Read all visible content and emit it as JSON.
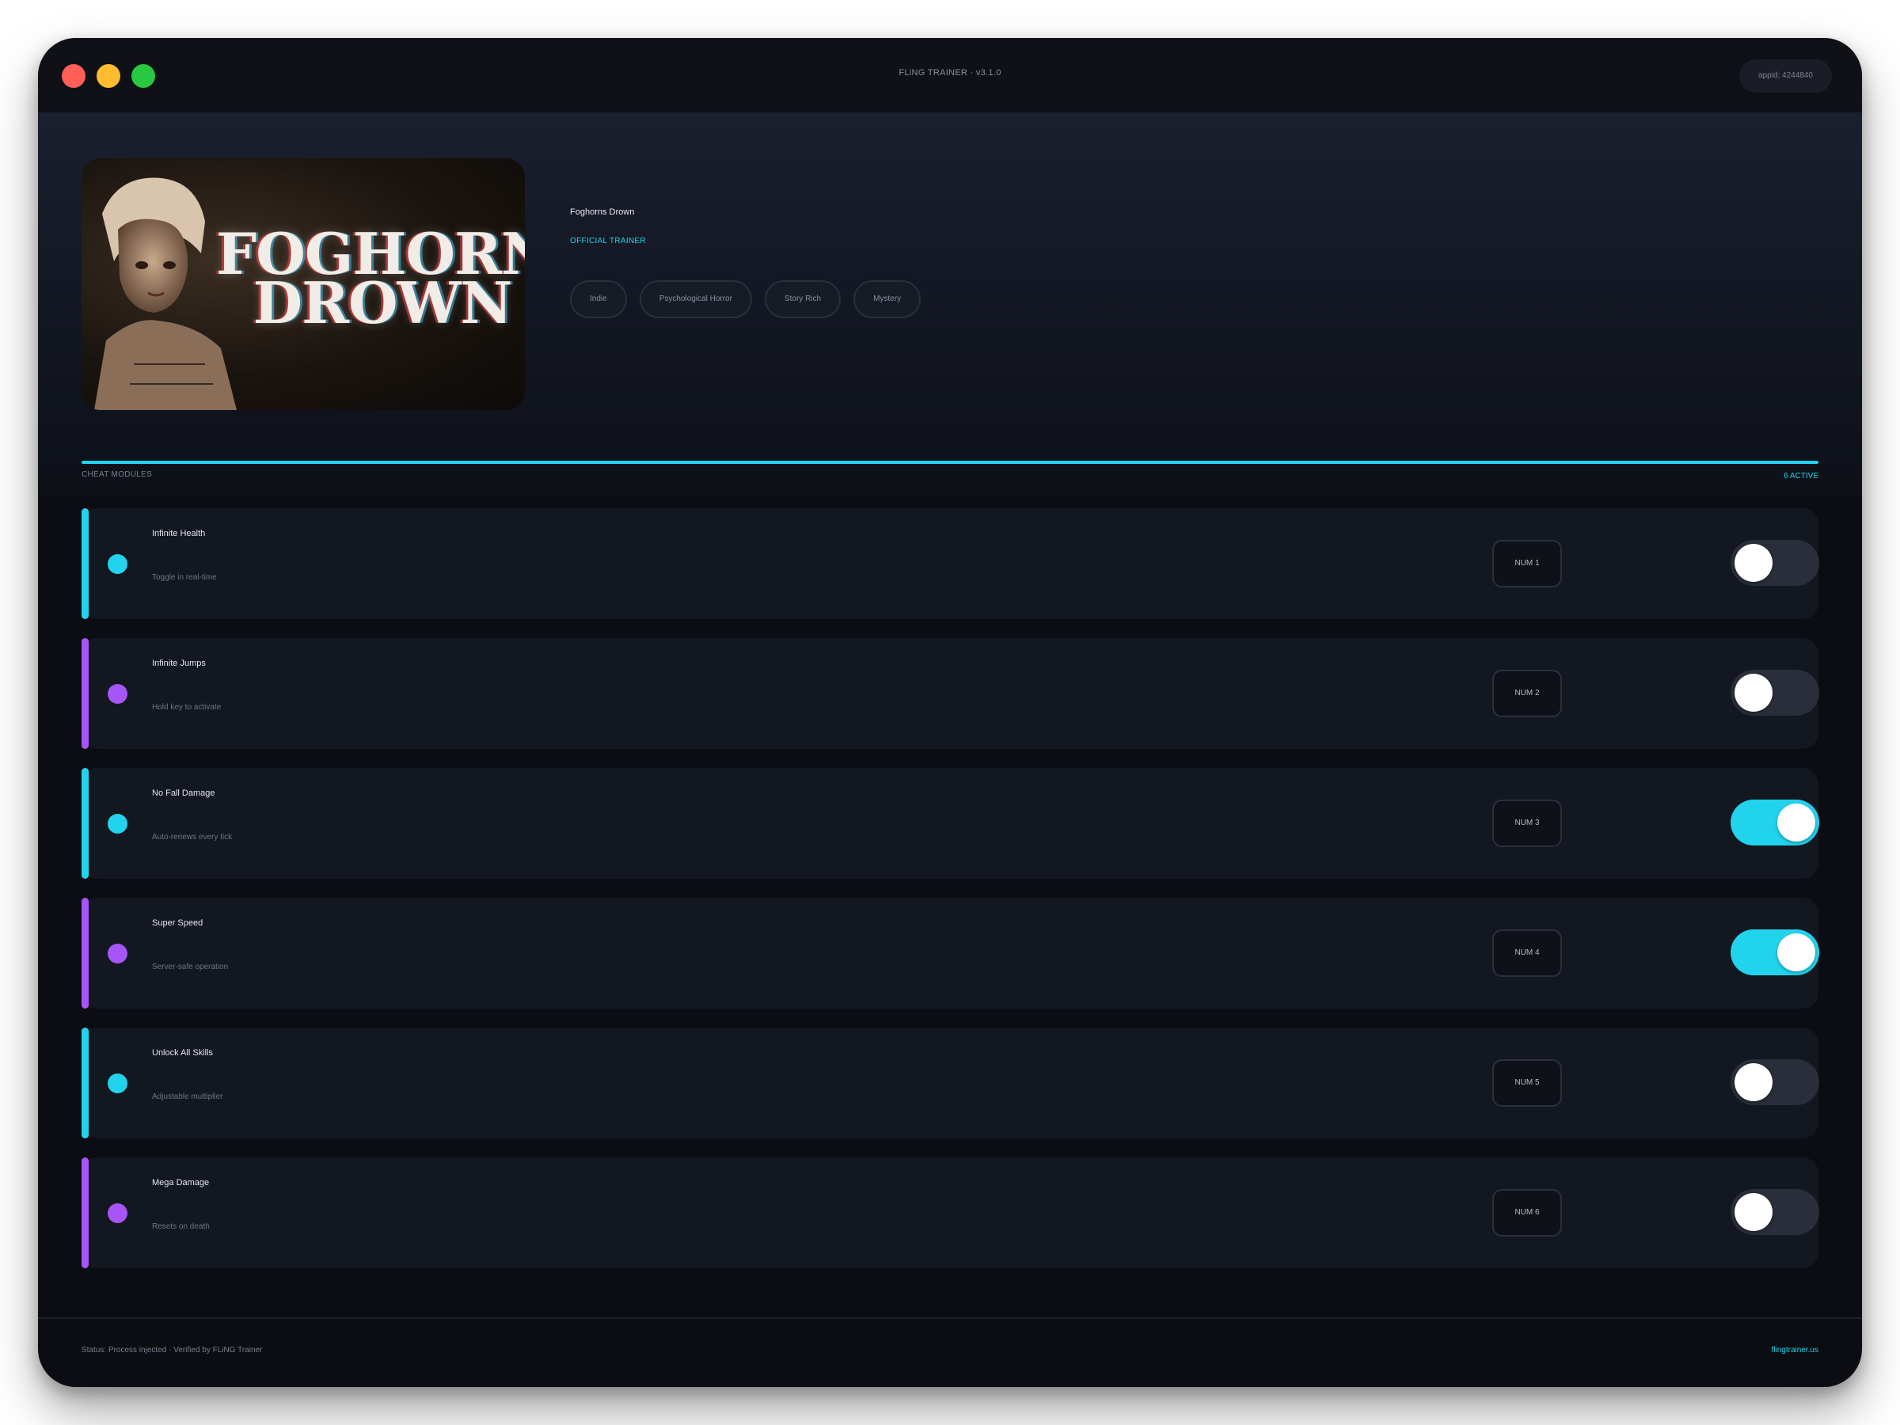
{
  "window": {
    "title": "FLiNG TRAINER · v3.1.0",
    "appid": "appid: 4244840"
  },
  "game": {
    "name": "Foghorns Drown",
    "cover_title_line1": "FOGHORNS",
    "cover_title_line2": "DROWN",
    "badge": "OFFICIAL TRAINER",
    "tags": [
      "Indie",
      "Psychological Horror",
      "Story Rich",
      "Mystery"
    ]
  },
  "modules": {
    "label": "CHEAT MODULES",
    "active_count": "6 ACTIVE",
    "items": [
      {
        "name": "Infinite Health",
        "desc": "Toggle in real-time",
        "key": "NUM 1",
        "on": false,
        "accent": "#22d3ee"
      },
      {
        "name": "Infinite Jumps",
        "desc": "Hold key to activate",
        "key": "NUM 2",
        "on": false,
        "accent": "#a855f7"
      },
      {
        "name": "No Fall Damage",
        "desc": "Auto-renews every tick",
        "key": "NUM 3",
        "on": true,
        "accent": "#22d3ee"
      },
      {
        "name": "Super Speed",
        "desc": "Server-safe operation",
        "key": "NUM 4",
        "on": true,
        "accent": "#a855f7"
      },
      {
        "name": "Unlock All Skills",
        "desc": "Adjustable multiplier",
        "key": "NUM 5",
        "on": false,
        "accent": "#22d3ee"
      },
      {
        "name": "Mega Damage",
        "desc": "Resets on death",
        "key": "NUM 6",
        "on": false,
        "accent": "#a855f7"
      }
    ]
  },
  "footer": {
    "status": "Status: Process injected · Verified by FLiNG Trainer",
    "site": "flingtrainer.us"
  },
  "colors": {
    "accent_cyan": "#22d3ee",
    "accent_purple": "#a855f7",
    "toggle_off": "#2a2e3a",
    "background": "#0b0d12"
  }
}
